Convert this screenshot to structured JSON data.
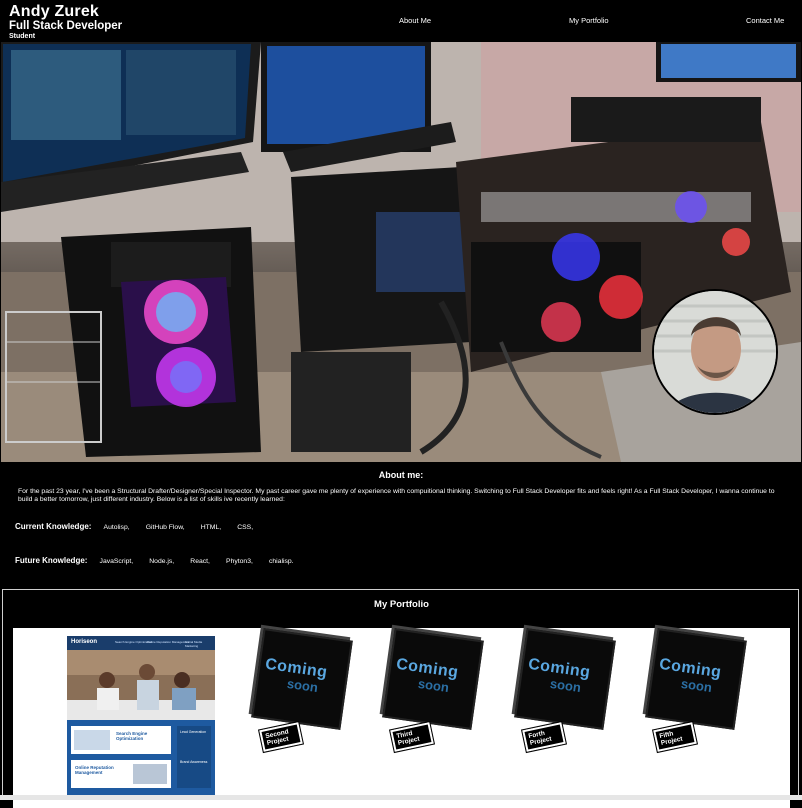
{
  "header": {
    "name": "Andy Zurek",
    "role": "Full Stack Developer",
    "subtitle": "Student",
    "nav": [
      "About Me",
      "My Portfolio",
      "Contact Me"
    ]
  },
  "hero": {
    "image": "computer mining rigs photo",
    "avatar": "profile photo"
  },
  "about": {
    "title": "About me:",
    "text": "For the past 23 year, I've been a Structural Drafter/Designer/Special Inspector. My past career gave me plenty of experience with compuitional thinking. Switching to Full Stack Developer fits and feels right! As a Full Stack Developer, I wanna continue to build a better tomorrow, just different industry. Below is a list of skills ive recently learned:",
    "current_label": "Current Knowledge:",
    "current_skills": [
      "Autolisp,",
      "GitHub Flow,",
      "HTML,",
      "CSS,"
    ],
    "future_label": "Future Knowledge:",
    "future_skills": [
      "JavaScript,",
      "Node.js,",
      "React,",
      "Phyton3,",
      "chialisp."
    ]
  },
  "portfolio": {
    "title": "My Portfolio",
    "featured": {
      "brand": "Horiseon",
      "menu": [
        "Search Engine Optimization",
        "Online Reputation Management",
        "Social Media Marketing"
      ],
      "card1": "Search Engine Optimization",
      "card2": "Online Reputation Management",
      "side1": "Lead Generation",
      "side2": "Brand Awareness"
    },
    "projects": [
      {
        "label": "Second Project",
        "word1": "Coming",
        "word2": "soon"
      },
      {
        "label": "Third Project",
        "word1": "Coming",
        "word2": "soon"
      },
      {
        "label": "Forth Project",
        "word1": "Coming",
        "word2": "soon"
      },
      {
        "label": "Fifth Project",
        "word1": "Coming",
        "word2": "soon"
      }
    ]
  }
}
